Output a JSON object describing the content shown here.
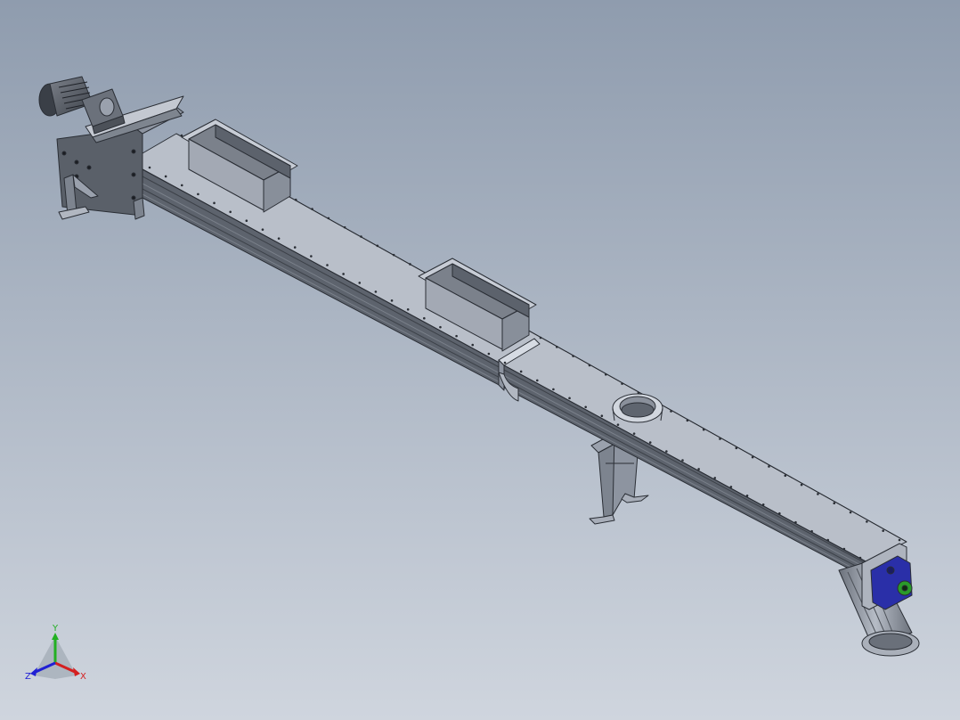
{
  "viewport": {
    "background_top": "#8f9cae",
    "background_bottom": "#cfd5de"
  },
  "model": {
    "steel_light": "#c9ced8",
    "steel_mid": "#9aa1ad",
    "steel_dark": "#5d636d",
    "bearing_blue": "#2a2fa8",
    "bearing_green": "#2a9a2a"
  },
  "triad": {
    "labels": {
      "x": "X",
      "y": "Y",
      "z": "Z"
    },
    "colors": {
      "x": "#d42020",
      "y": "#22b022",
      "z": "#2020d4"
    }
  }
}
